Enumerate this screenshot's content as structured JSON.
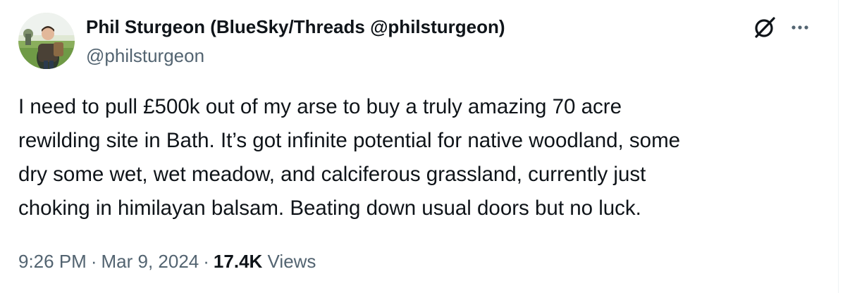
{
  "author": {
    "display_name": "Phil Sturgeon (BlueSky/Threads @philsturgeon)",
    "handle": "@philsturgeon"
  },
  "tweet": {
    "text": "I need to pull £500k out of my arse to buy a truly amazing 70 acre\nrewilding site in Bath. It’s got infinite potential for native woodland, some\ndry some wet, wet meadow, and calciferous grassland, currently just\nchoking in himilayan balsam. Beating down usual doors but no luck."
  },
  "meta": {
    "time": "9:26 PM",
    "separator": "·",
    "date": "Mar 9, 2024",
    "views_count": "17.4K",
    "views_label": "Views"
  },
  "icons": {
    "grok": "grok-icon",
    "more": "more-icon"
  },
  "colors": {
    "primary_text": "#0f1419",
    "secondary_text": "#536471"
  }
}
